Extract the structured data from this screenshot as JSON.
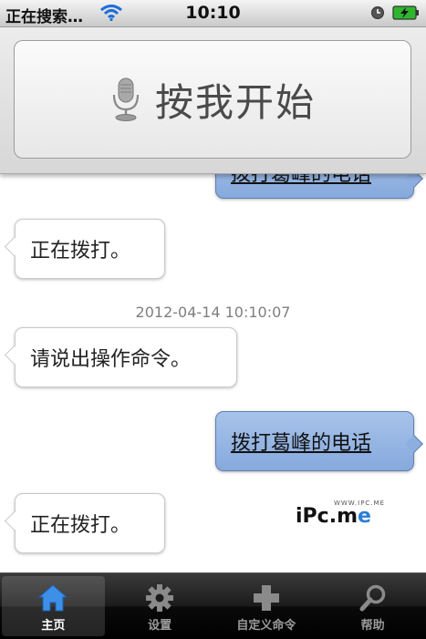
{
  "status_bar": {
    "carrier": "正在搜索…",
    "time": "10:10"
  },
  "voice_panel": {
    "start_label": "按我开始"
  },
  "conversation": {
    "messages": [
      {
        "role": "user",
        "text": "拨打葛峰的电话"
      },
      {
        "role": "system",
        "text": "正在拨打。"
      },
      {
        "role": "system",
        "text": "请说出操作命令。"
      },
      {
        "role": "user",
        "text": "拨打葛峰的电话"
      },
      {
        "role": "system",
        "text": "正在拨打。"
      }
    ],
    "timestamp": "2012-04-14 10:10:07"
  },
  "watermark": {
    "small": "WWW.IPC.ME",
    "prefix": "iPc.m",
    "suffix": "e"
  },
  "tab_bar": {
    "tabs": [
      {
        "label": "主页",
        "icon": "home-icon",
        "active": true
      },
      {
        "label": "设置",
        "icon": "gear-icon",
        "active": false
      },
      {
        "label": "自定义命令",
        "icon": "plus-icon",
        "active": false
      },
      {
        "label": "帮助",
        "icon": "magnifier-icon",
        "active": false
      }
    ]
  },
  "colors": {
    "user_bubble": "#8dafe0",
    "active_tab_icon": "#3d8fe8",
    "accent": "#2a7fd3"
  }
}
